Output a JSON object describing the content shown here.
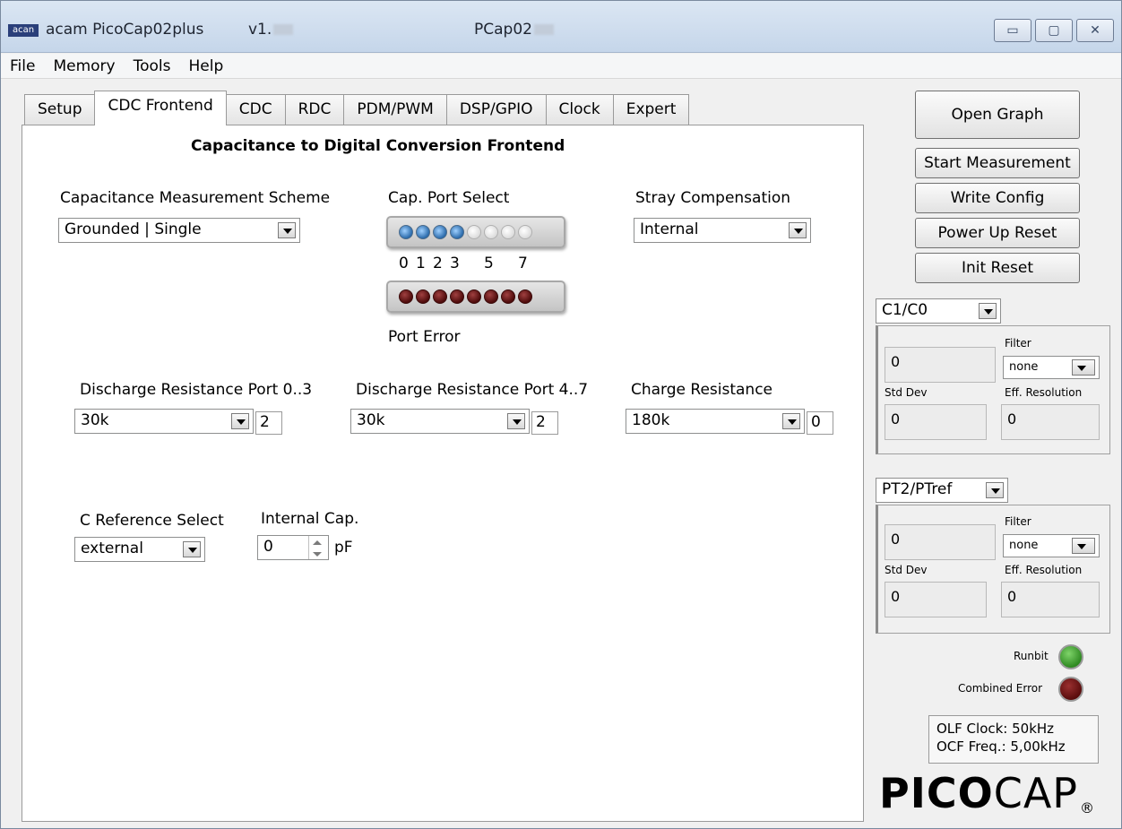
{
  "window": {
    "app_icon_text": "acan",
    "title": "acam PicoCap02plus",
    "version": "v1.",
    "device": "PCap02",
    "minimize_icon": "minimize-icon",
    "maximize_icon": "maximize-icon",
    "close_icon": "close-icon"
  },
  "menu": [
    "File",
    "Memory",
    "Tools",
    "Help"
  ],
  "tabs": [
    "Setup",
    "CDC Frontend",
    "CDC",
    "RDC",
    "PDM/PWM",
    "DSP/GPIO",
    "Clock",
    "Expert"
  ],
  "active_tab": "CDC Frontend",
  "panel": {
    "heading": "Capacitance to Digital Conversion Frontend",
    "scheme": {
      "label": "Capacitance Measurement Scheme",
      "value": "Grounded | Single"
    },
    "port_select": {
      "label": "Cap. Port Select",
      "states": [
        true,
        true,
        true,
        true,
        false,
        false,
        false,
        false
      ],
      "tick_labels": [
        "0",
        "1",
        "2",
        "3",
        "5",
        "7"
      ],
      "error_label": "Port Error",
      "error_count": 8
    },
    "stray": {
      "label": "Stray Compensation",
      "value": "Internal"
    },
    "discharge_03": {
      "label": "Discharge Resistance Port 0..3",
      "value": "30k",
      "num": "2"
    },
    "discharge_47": {
      "label": "Discharge Resistance Port 4..7",
      "value": "30k",
      "num": "2"
    },
    "charge": {
      "label": "Charge Resistance",
      "value": "180k",
      "num": "0"
    },
    "cref": {
      "label": "C Reference Select",
      "value": "external"
    },
    "internal_cap": {
      "label": "Internal Cap.",
      "value": "0",
      "unit": "pF"
    }
  },
  "side": {
    "open_graph": "Open Graph",
    "start_measurement": "Start Measurement",
    "write_config": "Write Config",
    "power_up_reset": "Power Up Reset",
    "init_reset": "Init Reset",
    "group1": {
      "select": "C1/C0",
      "value": "0",
      "filter_label": "Filter",
      "filter_value": "none",
      "std_dev_label": "Std Dev",
      "std_dev": "0",
      "eff_res_label": "Eff. Resolution",
      "eff_res": "0"
    },
    "group2": {
      "select": "PT2/PTref",
      "value": "0",
      "filter_label": "Filter",
      "filter_value": "none",
      "std_dev_label": "Std Dev",
      "std_dev": "0",
      "eff_res_label": "Eff. Resolution",
      "eff_res": "0"
    },
    "runbit_label": "Runbit",
    "combined_error_label": "Combined Error",
    "runbit_color": "#2f8a22",
    "combined_error_color": "#5a0c0c",
    "olf_clock": "OLF Clock: 50kHz",
    "ocf_freq": "OCF Freq.: 5,00kHz",
    "logo_bold": "PICO",
    "logo_regular": "CAP",
    "logo_reg_mark": "®"
  }
}
